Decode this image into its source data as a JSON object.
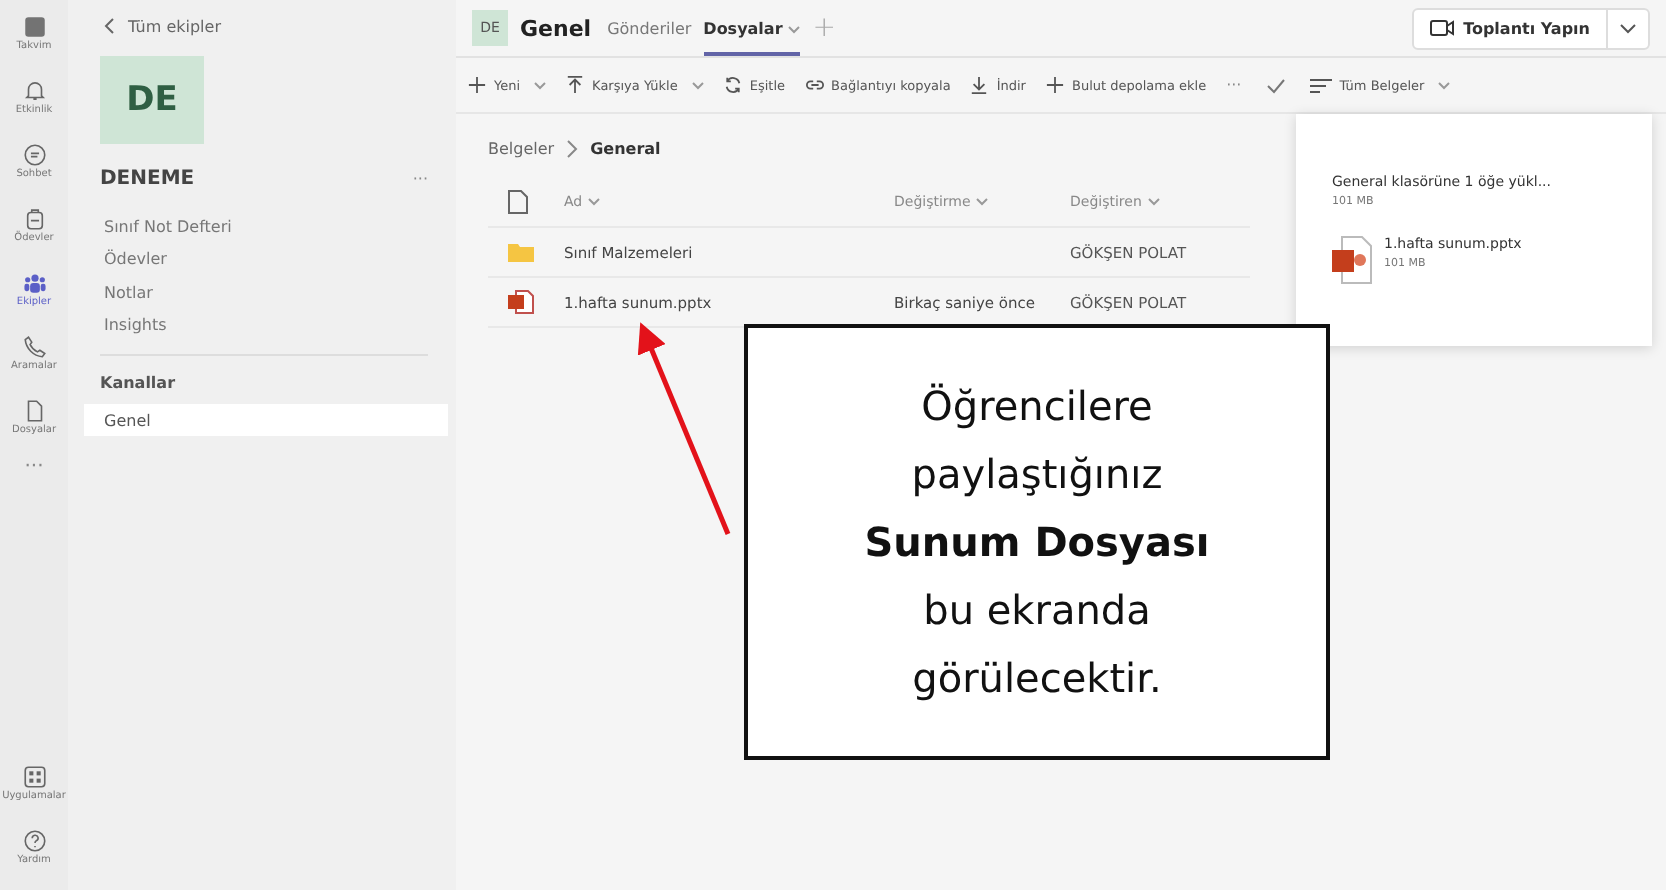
{
  "rail": {
    "items": [
      {
        "label": "Takvim",
        "selected": false
      },
      {
        "label": "Etkinlik",
        "selected": false
      },
      {
        "label": "Sohbet",
        "selected": false
      },
      {
        "label": "Ödevler",
        "selected": false
      },
      {
        "label": "Ekipler",
        "selected": true
      },
      {
        "label": "Aramalar",
        "selected": false
      },
      {
        "label": "Dosyalar",
        "selected": false
      }
    ],
    "more": "···",
    "bottom_items": [
      {
        "label": "Uygulamalar",
        "selected": false
      },
      {
        "label": "Yardım",
        "selected": false
      }
    ]
  },
  "sidebar": {
    "back": "Tüm ekipler",
    "team_initials": "DE",
    "team_name": "DENEME",
    "more": "···",
    "items": [
      "Sınıf Not Defteri",
      "Ödevler",
      "Notlar",
      "Insights"
    ],
    "channels_heading": "Kanallar",
    "channels": [
      {
        "label": "Genel",
        "selected": true
      }
    ]
  },
  "header": {
    "initials": "DE",
    "channel": "Genel",
    "tabs": [
      {
        "label": "Gönderiler",
        "selected": false,
        "dropdown": false
      },
      {
        "label": "Dosyalar",
        "selected": true,
        "dropdown": true
      }
    ],
    "add": "+",
    "meet_button": "Toplantı Yapın"
  },
  "toolbar": {
    "items": [
      {
        "label": "Yeni",
        "dropdown": true
      },
      {
        "label": "Karşıya Yükle",
        "dropdown": true
      },
      {
        "label": "Eşitle",
        "dropdown": false
      },
      {
        "label": "Bağlantıyı kopyala",
        "dropdown": false
      },
      {
        "label": "İndir",
        "dropdown": false
      },
      {
        "label": "Bulut depolama ekle",
        "dropdown": false
      }
    ],
    "more": "···",
    "view": "Tüm Belgeler"
  },
  "breadcrumb": [
    "Belgeler",
    "General"
  ],
  "table": {
    "columns": [
      "Ad",
      "Değiştirme",
      "Değiştiren"
    ],
    "rows": [
      {
        "kind": "folder",
        "name": "Sınıf Malzemeleri",
        "modified_by": "GÖKŞEN POLAT"
      },
      {
        "kind": "pptx",
        "name": "1.hafta sunum.pptx",
        "modified": "Birkaç saniye önce",
        "modified_by": "GÖKŞEN POLAT"
      }
    ]
  },
  "upload_panel": {
    "title": "General klasörüne 1 öğe yükl...",
    "size": "101 MB",
    "file": {
      "name": "1.hafta sunum.pptx",
      "size": "101 MB"
    }
  },
  "callout": {
    "text": "Öğrencilere paylaştığınız **Sunum Dosyası** bu ekranda görülecektir."
  }
}
